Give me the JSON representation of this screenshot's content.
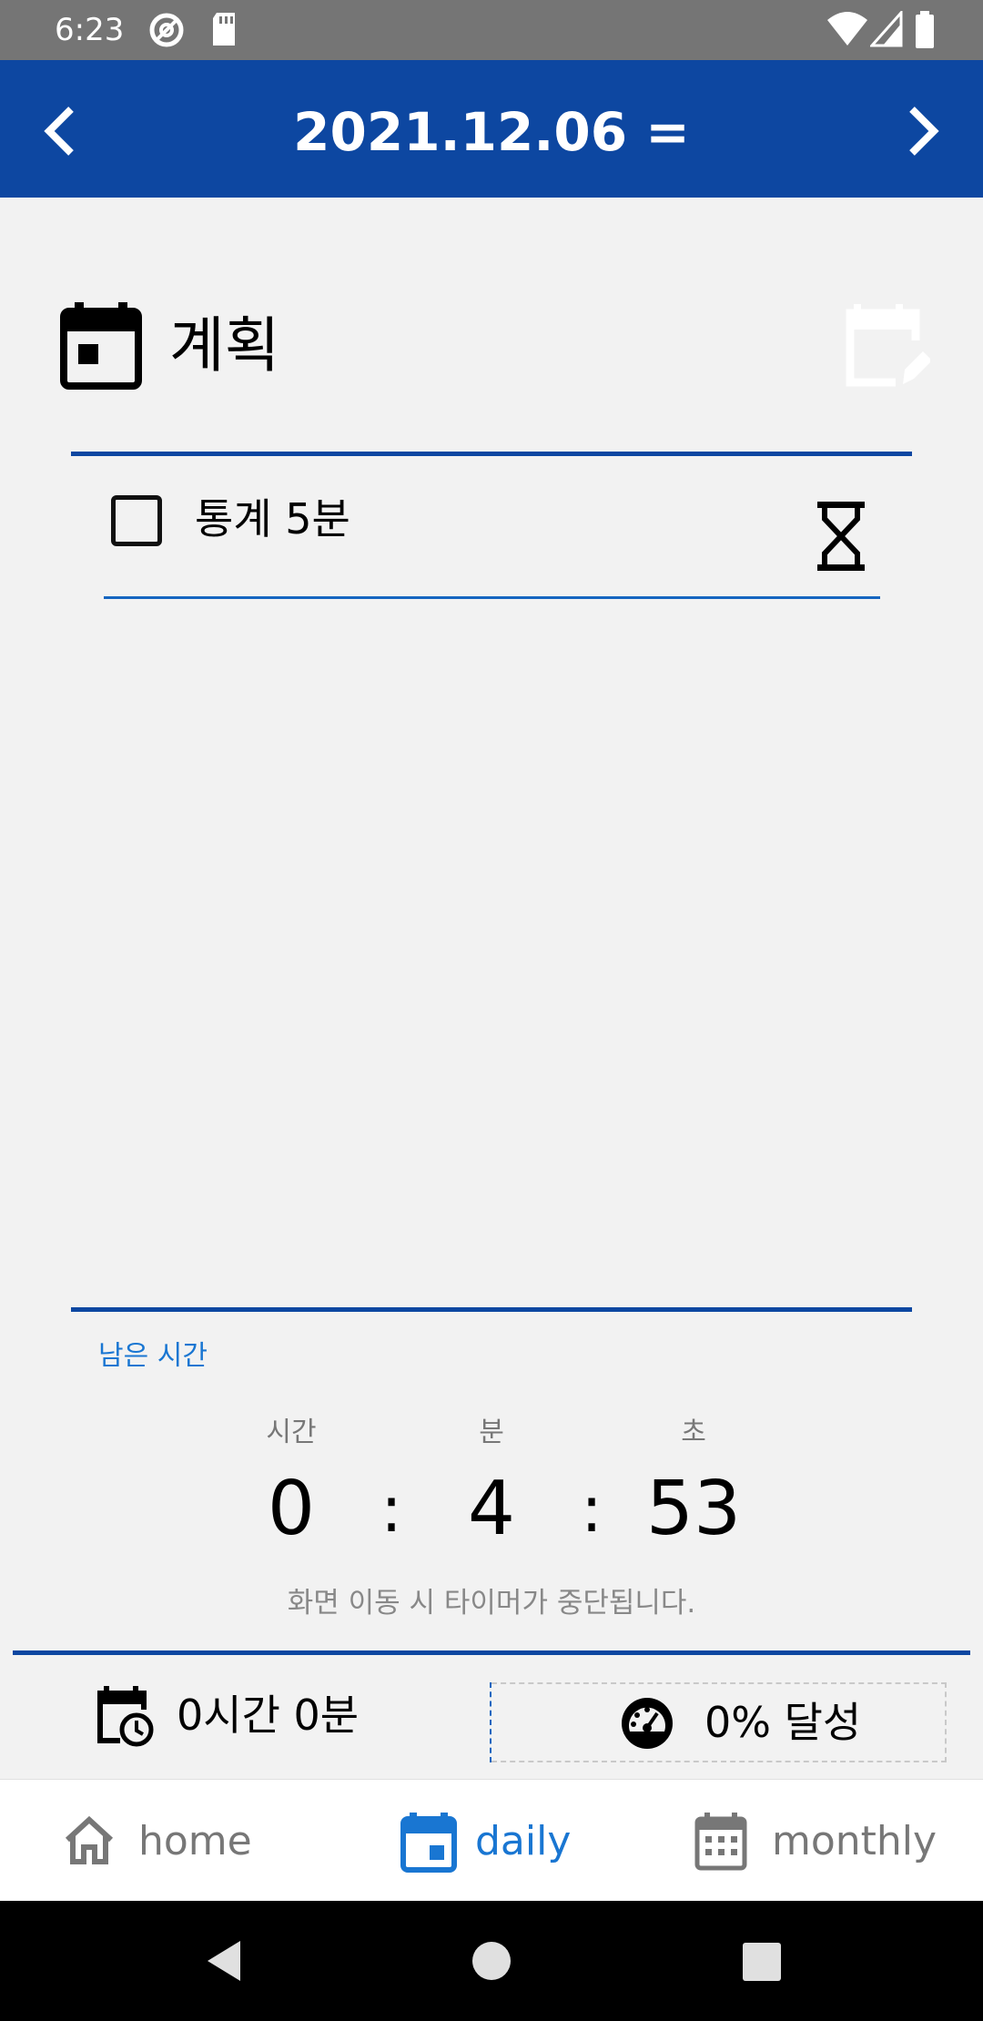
{
  "status_bar": {
    "time": "6:23",
    "icons": [
      "at-sign-icon",
      "sd-card-icon",
      "wifi-icon",
      "signal-icon",
      "battery-icon"
    ]
  },
  "app_bar": {
    "title": "2021.12.06 =",
    "prev_icon": "chevron-left-icon",
    "next_icon": "chevron-right-icon",
    "background": "#0d47a1"
  },
  "plan": {
    "title": "계획",
    "header_icon": "calendar-today-icon",
    "edit_icon": "calendar-edit-icon",
    "items": [
      {
        "label": "통계 5분",
        "checked": false,
        "action_icon": "hourglass-icon"
      }
    ]
  },
  "remaining": {
    "label": "남은 시간",
    "units": {
      "hours": "시간",
      "minutes": "분",
      "seconds": "초"
    },
    "hours": "0",
    "minutes": "4",
    "seconds": "53",
    "separator": ":",
    "notice": "화면 이동 시 타이머가 중단됩니다."
  },
  "summary": {
    "total_time": "0시간 0분",
    "total_time_icon": "calendar-clock-icon",
    "achievement": "0% 달성",
    "achievement_icon": "speedometer-icon"
  },
  "bottom_nav": {
    "items": [
      {
        "label": "home",
        "icon": "home-icon",
        "active": false
      },
      {
        "label": "daily",
        "icon": "calendar-today-icon",
        "active": true
      },
      {
        "label": "monthly",
        "icon": "calendar-month-icon",
        "active": false
      }
    ],
    "active_color": "#1976d2",
    "inactive_color": "#777777"
  },
  "system_nav": {
    "icons": [
      "back-triangle-icon",
      "home-circle-icon",
      "recents-square-icon"
    ]
  }
}
